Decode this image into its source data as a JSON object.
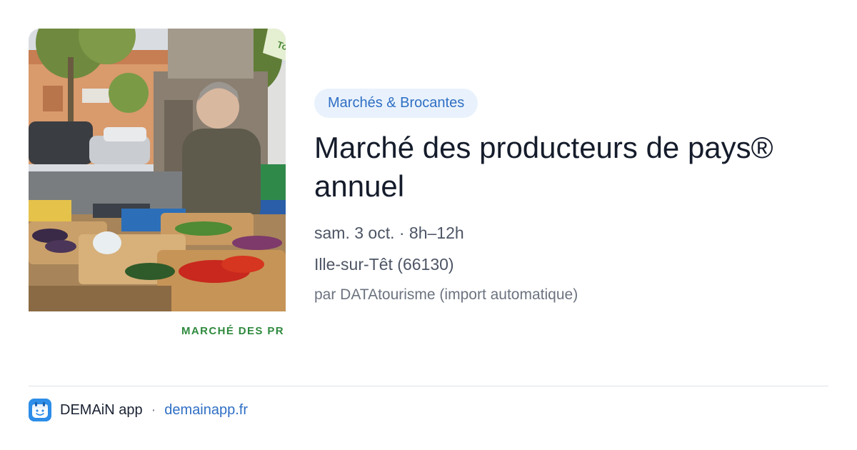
{
  "image": {
    "caption": "MARCHÉ DES PR",
    "sign_text": "To"
  },
  "category": "Marchés & Brocantes",
  "title": "Marché des producteurs de pays® annuel",
  "date_time": "sam. 3 oct. · 8h–12h",
  "location": "Ille-sur-Têt (66130)",
  "source": "par DATAtourisme (import automatique)",
  "footer": {
    "app_name": "DEMAiN app",
    "separator": "·",
    "url": "demainapp.fr"
  },
  "colors": {
    "accent": "#2f6fc4",
    "badge_bg": "#e9f2fc",
    "caption_green": "#2f8a3e",
    "logo_blue": "#2d8de8"
  }
}
